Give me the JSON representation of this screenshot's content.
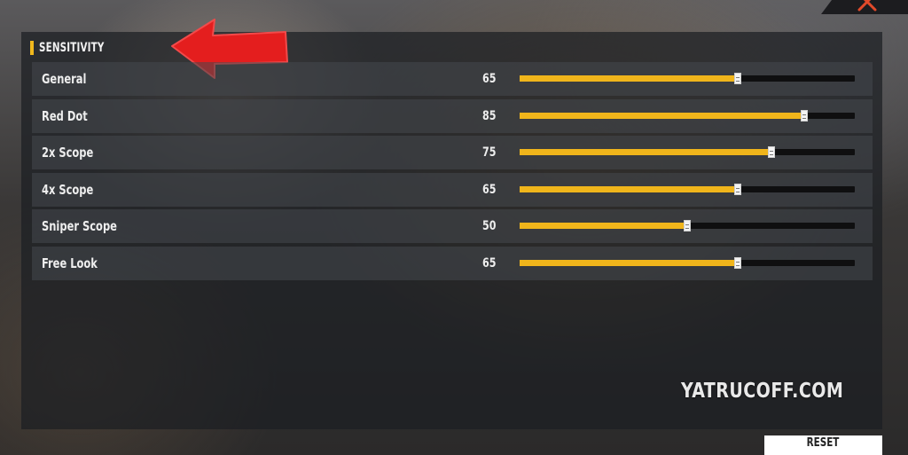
{
  "header": {
    "title": "SENSITIVITY"
  },
  "sensitivity": {
    "max": 100,
    "rows": [
      {
        "label": "General",
        "value": "65"
      },
      {
        "label": "Red Dot",
        "value": "85"
      },
      {
        "label": "2x Scope",
        "value": "75"
      },
      {
        "label": "4x Scope",
        "value": "65"
      },
      {
        "label": "Sniper Scope",
        "value": "50"
      },
      {
        "label": "Free Look",
        "value": "65"
      }
    ]
  },
  "footer": {
    "reset_label": "RESET"
  },
  "watermark": "YATRUCOFF.COM",
  "colors": {
    "accent": "#f0b51b",
    "track": "#0f0f10",
    "arrow": "#e41e1e"
  },
  "icons": {
    "close": "close-icon",
    "annotation": "red-arrow-icon"
  }
}
